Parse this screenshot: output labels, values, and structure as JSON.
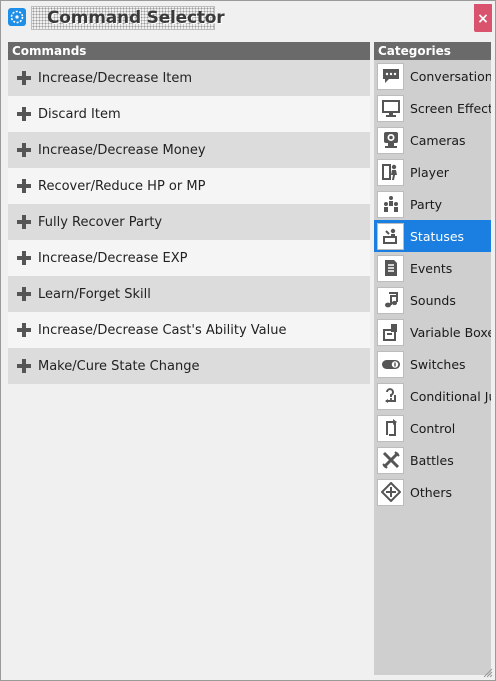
{
  "window": {
    "title": "Command Selector",
    "close_glyph": "×",
    "accent": "#1a7fe0",
    "close_color": "#d9536e"
  },
  "commands": {
    "header": "Commands",
    "items": [
      "Increase/Decrease Item",
      "Discard Item",
      "Increase/Decrease Money",
      "Recover/Reduce HP or MP",
      "Fully Recover Party",
      "Increase/Decrease EXP",
      "Learn/Forget Skill",
      "Increase/Decrease Cast's Ability Value",
      "Make/Cure State Change"
    ]
  },
  "categories": {
    "header": "Categories",
    "selected": "Statuses",
    "items": [
      {
        "label": "Conversation",
        "icon": "speech-bubble-icon"
      },
      {
        "label": "Screen Effects",
        "icon": "monitor-icon"
      },
      {
        "label": "Cameras",
        "icon": "camera-icon"
      },
      {
        "label": "Player",
        "icon": "player-icon"
      },
      {
        "label": "Party",
        "icon": "party-icon"
      },
      {
        "label": "Statuses",
        "icon": "status-icon"
      },
      {
        "label": "Events",
        "icon": "events-icon"
      },
      {
        "label": "Sounds",
        "icon": "music-note-icon"
      },
      {
        "label": "Variable Boxes",
        "icon": "variable-box-icon"
      },
      {
        "label": "Switches",
        "icon": "switch-icon"
      },
      {
        "label": "Conditional Jumps",
        "icon": "conditional-jump-icon"
      },
      {
        "label": "Control",
        "icon": "control-icon"
      },
      {
        "label": "Battles",
        "icon": "crossed-swords-icon"
      },
      {
        "label": "Others",
        "icon": "others-icon"
      }
    ]
  }
}
